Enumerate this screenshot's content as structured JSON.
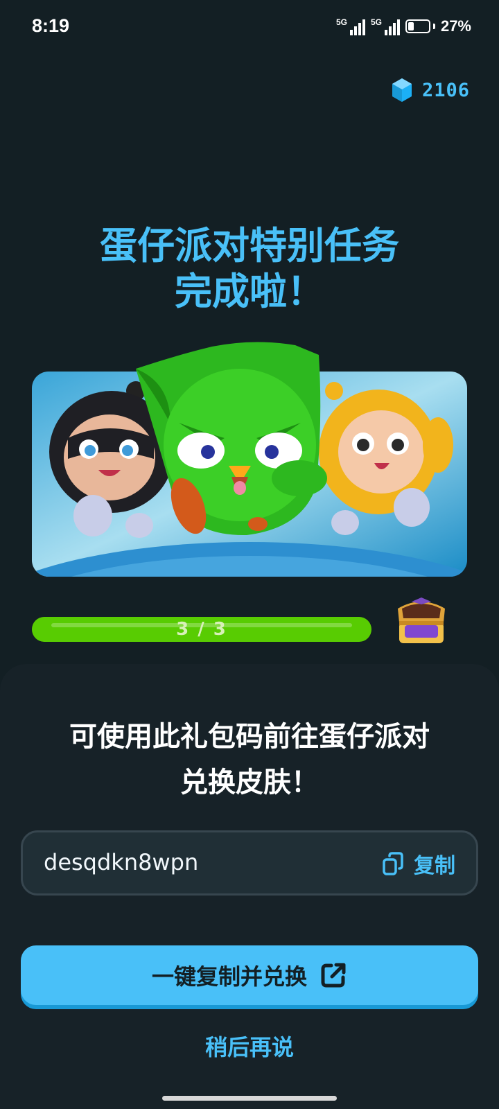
{
  "status_bar": {
    "time": "8:19",
    "network_1": "5G",
    "network_2": "5G",
    "battery_percent": "27%",
    "battery_level": 0.27
  },
  "gems": {
    "icon": "gem-icon",
    "count": "2106"
  },
  "headline": {
    "line1": "蛋仔派对特别任务",
    "line2": "完成啦！"
  },
  "hero": {
    "icon": "mascot-illustration"
  },
  "progress": {
    "label": "3 / 3",
    "value": 3,
    "max": 3,
    "reward_icon": "treasure-chest-icon"
  },
  "sheet": {
    "title_line1": "可使用此礼包码前往蛋仔派对",
    "title_line2": "兑换皮肤！",
    "code": "desqdkn8wpn",
    "copy_label": "复制",
    "copy_icon": "copy-icon",
    "primary_label": "一键复制并兑换",
    "primary_icon": "external-link-icon",
    "later_label": "稍后再说"
  },
  "colors": {
    "background": "#131f24",
    "sheet": "#172228",
    "accent_blue": "#49c0f8",
    "progress_green": "#58cc02"
  }
}
